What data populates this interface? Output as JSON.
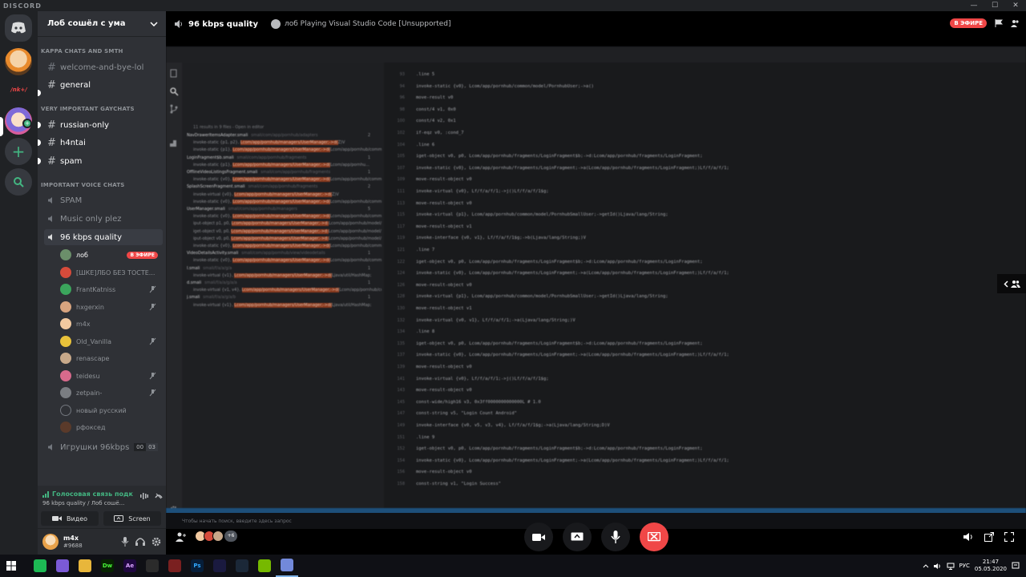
{
  "app": {
    "brand": "DISCORD",
    "window_controls": [
      "—",
      "☐",
      "✕"
    ]
  },
  "rail": {
    "label": "/nk+/",
    "new_badge": "+"
  },
  "guild": {
    "name": "Лоб сошёл с ума",
    "categories": [
      {
        "label": "KAPPA CHATS AND SMTH"
      },
      {
        "label": "VERY IMPORTANT GAYCHATS"
      },
      {
        "label": "IMPORTANT VOICE CHATS"
      }
    ],
    "text_channels": [
      {
        "label": "welcome-and-bye-lol",
        "unread": false
      },
      {
        "label": "general",
        "unread": true
      },
      {
        "label": "russian-only",
        "unread": true
      },
      {
        "label": "h4ntai",
        "unread": true
      },
      {
        "label": "spam",
        "unread": true
      }
    ],
    "voice_channels": [
      {
        "label": "SPAM"
      },
      {
        "label": "Music only plez"
      },
      {
        "label": "96 kbps quality"
      },
      {
        "label": "Игрушки 96kbps",
        "counts": [
          "00",
          "03"
        ]
      }
    ],
    "voice_users": [
      {
        "name": "лоб",
        "live": "В ЭФИРЕ",
        "color": "#6b8f6a"
      },
      {
        "name": "[ШКЕ]ЛБО БЕЗ ТОСТЕ...",
        "color": "#d64b3b"
      },
      {
        "name": "FrantKatniss",
        "color": "#3ba55c"
      },
      {
        "name": "hxgerxin",
        "color": "#d8a47f"
      },
      {
        "name": "m4x",
        "color": "#f2c9a0"
      },
      {
        "name": "Old_Vanilla",
        "color": "#e9c23a"
      },
      {
        "name": "renascape",
        "color": "#c8a98a"
      },
      {
        "name": "teidesu",
        "color": "#d86a8c"
      },
      {
        "name": "zetpain-",
        "color": "#7a7d82"
      },
      {
        "name": "новый русский",
        "color": "#2f3136"
      },
      {
        "name": "рфоксед",
        "color": "#5a3a2a"
      }
    ]
  },
  "voice_panel": {
    "status": "Голосовая связь подк",
    "sub": "96 kbps quality / Лоб сошё...",
    "video_label": "Видео",
    "screen_label": "Screen"
  },
  "user": {
    "name": "m4x",
    "tag": "#9688"
  },
  "stream": {
    "channel": "96 kbps quality",
    "activity": "лоб Playing Visual Studio Code [Unsupported]",
    "live": "В ЭФИРЕ",
    "search_placeholder": "Чтобы начать поиск, введите здесь запрос",
    "participants_more": "+6"
  },
  "vscode": {
    "explorer_header": "11 results in 9 files - Open in editor",
    "results": [
      {
        "file": "NavDrawerItemsAdapter.smali",
        "path": "smali/com/app/pornhub/adapters",
        "count": "2"
      },
      {
        "text": "invoke-static {p1, p2}, ",
        "hl": "Lcom/app/pornhub/managers/UserManager;->d(",
        "tail": "Z)V"
      },
      {
        "text": "invoke-static {p1}, ",
        "hl": "Lcom/app/pornhub/managers/UserManager;->d(",
        "tail": "Lcom/app/pornhub/commo..."
      },
      {
        "file": "LoginFragment$b.smali",
        "path": "smali/com/app/pornhub/fragments",
        "count": "1"
      },
      {
        "text": "invoke-static {p1}, ",
        "hl": "Lcom/app/pornhub/managers/UserManager;->d(",
        "tail": "Lcom/app/pornhu..."
      },
      {
        "file": "OfflineVideoListingsFragment.smali",
        "path": "smali/com/app/pornhub/fragments",
        "count": "1"
      },
      {
        "text": "invoke-static {v0}, ",
        "hl": "Lcom/app/pornhub/managers/UserManager;->d(",
        "tail": "Lcom/app/pornhub/commo..."
      },
      {
        "file": "SplashScreenFragment.smali",
        "path": "smali/com/app/pornhub/fragments",
        "count": "2"
      },
      {
        "text": "invoke-virtual {v0}, ",
        "hl": "Lcom/app/pornhub/managers/UserManager;->d(",
        "tail": "Z)V"
      },
      {
        "text": "invoke-static {v0}, ",
        "hl": "Lcom/app/pornhub/managers/UserManager;->d(",
        "tail": "Lcom/app/pornhub/commo..."
      },
      {
        "file": "UserManager.smali",
        "path": "smali/com/app/pornhub/managers",
        "count": "5"
      },
      {
        "text": "invoke-static {v0}, ",
        "hl": "Lcom/app/pornhub/managers/UserManager;->d(",
        "tail": "Lcom/app/pornhub/commo..."
      },
      {
        "text": "iput-object p1, p0, ",
        "hl": "Lcom/app/pornhub/managers/UserManager;->d:",
        "tail": "Lcom/app/pornhub/model/..."
      },
      {
        "text": "iget-object v0, p0, ",
        "hl": "Lcom/app/pornhub/managers/UserManager;->d:",
        "tail": "Lcom/app/pornhub/model/..."
      },
      {
        "text": "iput-object v0, p0, ",
        "hl": "Lcom/app/pornhub/managers/UserManager;->d:",
        "tail": "Lcom/app/pornhub/model/..."
      },
      {
        "text": "invoke-static {v0}, ",
        "hl": "Lcom/app/pornhub/managers/UserManager;->d(",
        "tail": "Lcom/app/pornhub/commo..."
      },
      {
        "file": "VideoDetailsActivity.smali",
        "path": "smali/com/app/pornhub/view/videodetails",
        "count": "1"
      },
      {
        "text": "invoke-static {v0}, ",
        "hl": "Lcom/app/pornhub/managers/UserManager;->d(",
        "tail": "Lcom/app/pornhub/commo..."
      },
      {
        "file": "l.smali",
        "path": "smali/f/a/a/g/a",
        "count": "1"
      },
      {
        "text": "invoke-virtual {v1}, ",
        "hl": "Lcom/app/pornhub/managers/UserManager;->d(",
        "tail": "Ljava/util/HashMap;"
      },
      {
        "file": "d.smali",
        "path": "smali/f/a/a/g/a/a",
        "count": "1"
      },
      {
        "text": "invoke-virtual {v1, v4}, ",
        "hl": "Lcom/app/pornhub/managers/UserManager;->d(",
        "tail": "Lcom/app/pornhub/co..."
      },
      {
        "file": "j.smali",
        "path": "smali/f/a/a/g/a/b",
        "count": "1"
      },
      {
        "text": "invoke-virtual {v1}, ",
        "hl": "Lcom/app/pornhub/managers/UserManager;->d(",
        "tail": "Ljava/util/HashMap;"
      }
    ],
    "code": [
      {
        "n": "93",
        "t": ".line 5"
      },
      {
        "n": "94",
        "t": "invoke-static {v0}, Lcom/app/pornhub/common/model/PornhubUser;->a()"
      },
      {
        "n": "96",
        "t": "move-result v0"
      },
      {
        "n": "98",
        "t": "const/4 v1, 0x0"
      },
      {
        "n": "100",
        "t": "const/4 v2, 0x1"
      },
      {
        "n": "102",
        "t": "if-eqz v0, :cond_7"
      },
      {
        "n": "104",
        "t": ".line 6"
      },
      {
        "n": "105",
        "t": "iget-object v0, p0, Lcom/app/pornhub/fragments/LoginFragment$b;->d:Lcom/app/pornhub/fragments/LoginFragment;"
      },
      {
        "n": "107",
        "t": "invoke-static {v0}, Lcom/app/pornhub/fragments/LoginFragment;->a(Lcom/app/pornhub/fragments/LoginFragment;)Lf/f/a/f/1;"
      },
      {
        "n": "109",
        "t": "move-result-object v0"
      },
      {
        "n": "111",
        "t": "invoke-virtual {v0}, Lf/f/a/f/1;->j()Lf/f/a/f/1$g;"
      },
      {
        "n": "113",
        "t": "move-result-object v0"
      },
      {
        "n": "115",
        "t": "invoke-virtual {p1}, Lcom/app/pornhub/common/model/PornhubSmallUser;->getId()Ljava/lang/String;"
      },
      {
        "n": "117",
        "t": "move-result-object v1"
      },
      {
        "n": "119",
        "t": "invoke-interface {v0, v1}, Lf/f/a/f/1$g;->b(Ljava/lang/String;)V"
      },
      {
        "n": "121",
        "t": ".line 7"
      },
      {
        "n": "122",
        "t": "iget-object v0, p0, Lcom/app/pornhub/fragments/LoginFragment$b;->d:Lcom/app/pornhub/fragments/LoginFragment;"
      },
      {
        "n": "124",
        "t": "invoke-static {v0}, Lcom/app/pornhub/fragments/LoginFragment;->a(Lcom/app/pornhub/fragments/LoginFragment;)Lf/f/a/f/1;"
      },
      {
        "n": "126",
        "t": "move-result-object v0"
      },
      {
        "n": "128",
        "t": "invoke-virtual {p1}, Lcom/app/pornhub/common/model/PornhubSmallUser;->getId()Ljava/lang/String;"
      },
      {
        "n": "130",
        "t": "move-result-object v1"
      },
      {
        "n": "132",
        "t": "invoke-virtual {v0, v1}, Lf/f/a/f/1;->a(Ljava/lang/String;)V"
      },
      {
        "n": "134",
        "t": ".line 8"
      },
      {
        "n": "135",
        "t": "iget-object v0, p0, Lcom/app/pornhub/fragments/LoginFragment$b;->d:Lcom/app/pornhub/fragments/LoginFragment;"
      },
      {
        "n": "137",
        "t": "invoke-static {v0}, Lcom/app/pornhub/fragments/LoginFragment;->a(Lcom/app/pornhub/fragments/LoginFragment;)Lf/f/a/f/1;"
      },
      {
        "n": "139",
        "t": "move-result-object v0"
      },
      {
        "n": "141",
        "t": "invoke-virtual {v0}, Lf/f/a/f/1;->j()Lf/f/a/f/1$g;"
      },
      {
        "n": "143",
        "t": "move-result-object v0"
      },
      {
        "n": "145",
        "t": "const-wide/high16 v3, 0x3ff0000000000000L    # 1.0"
      },
      {
        "n": "147",
        "t": "const-string v5, \"Login Count Android\""
      },
      {
        "n": "149",
        "t": "invoke-interface {v0, v5, v3, v4}, Lf/f/a/f/1$g;->a(Ljava/lang/String;D)V"
      },
      {
        "n": "151",
        "t": ".line 9"
      },
      {
        "n": "152",
        "t": "iget-object v0, p0, Lcom/app/pornhub/fragments/LoginFragment$b;->d:Lcom/app/pornhub/fragments/LoginFragment;"
      },
      {
        "n": "154",
        "t": "invoke-static {v0}, Lcom/app/pornhub/fragments/LoginFragment;->a(Lcom/app/pornhub/fragments/LoginFragment;)Lf/f/a/f/1;"
      },
      {
        "n": "156",
        "t": "move-result-object v0"
      },
      {
        "n": "158",
        "t": "const-string v1, \"Login Success\""
      }
    ]
  },
  "taskbar": {
    "apps": [
      {
        "name": "spotify",
        "label": "",
        "bg": "#1db954",
        "fg": "#000"
      },
      {
        "name": "mail",
        "label": "",
        "bg": "#7b5ad6",
        "fg": "#fff"
      },
      {
        "name": "explorer",
        "label": "",
        "bg": "#e8b63b",
        "fg": "#000"
      },
      {
        "name": "dreamweaver",
        "label": "Dw",
        "bg": "#072401",
        "fg": "#4af53a"
      },
      {
        "name": "after-effects",
        "label": "Ae",
        "bg": "#1f0740",
        "fg": "#d9a3ff"
      },
      {
        "name": "terminal",
        "label": "",
        "bg": "#2b2b2b",
        "fg": "#fff"
      },
      {
        "name": "winrar",
        "label": "",
        "bg": "#7a2020",
        "fg": "#fff"
      },
      {
        "name": "photoshop",
        "label": "Ps",
        "bg": "#061e3a",
        "fg": "#31a8ff"
      },
      {
        "name": "premiere",
        "label": "",
        "bg": "#1a1a3f",
        "fg": "#fff"
      },
      {
        "name": "steam",
        "label": "",
        "bg": "#1b2838",
        "fg": "#fff"
      },
      {
        "name": "nvidia",
        "label": "",
        "bg": "#76b900",
        "fg": "#000"
      },
      {
        "name": "discord",
        "label": "",
        "bg": "#7289da",
        "fg": "#fff"
      }
    ],
    "lang": "РУС",
    "time": "21:47",
    "date": "05.05.2020"
  },
  "colors": {
    "accent": "#7289da",
    "green": "#43b581",
    "red": "#f04747"
  }
}
